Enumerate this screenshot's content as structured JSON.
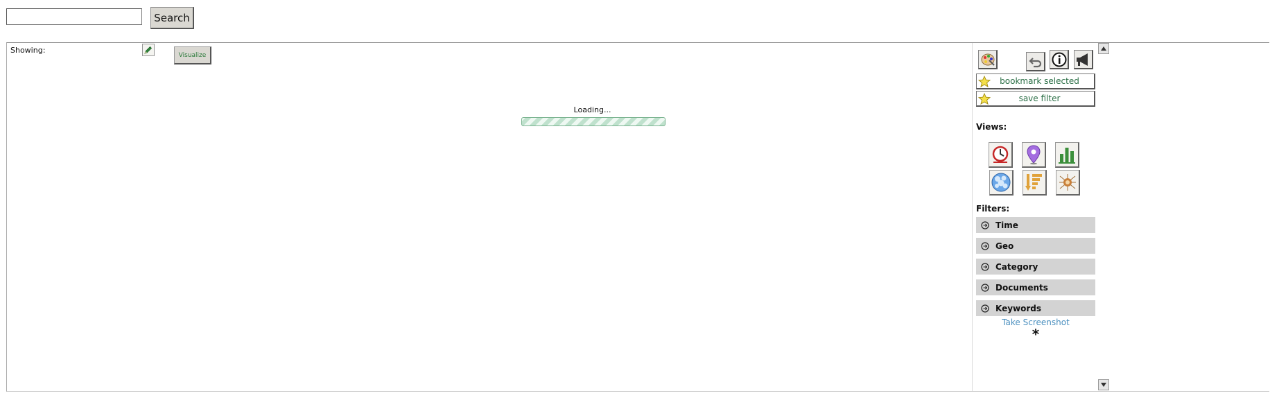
{
  "search": {
    "placeholder": "",
    "value": "",
    "button_label": "Search"
  },
  "main": {
    "showing_label": "Showing:",
    "visualize_label": "Visualize",
    "loading_text": "Loading..."
  },
  "toolbar": {
    "icons": [
      "palette-icon",
      "undo-icon",
      "info-icon",
      "megaphone-icon"
    ]
  },
  "actions": {
    "bookmark_label": "bookmark selected",
    "save_filter_label": "save filter"
  },
  "views": {
    "heading": "Views:",
    "items": [
      "timeline-view-icon",
      "map-view-icon",
      "bar-chart-view-icon",
      "tag-cloud-view-icon",
      "sorted-list-view-icon",
      "network-view-icon"
    ]
  },
  "filters": {
    "heading": "Filters:",
    "items": [
      {
        "label": "Time"
      },
      {
        "label": "Geo"
      },
      {
        "label": "Category"
      },
      {
        "label": "Documents"
      },
      {
        "label": "Keywords"
      }
    ]
  },
  "footer": {
    "screenshot_label": "Take Screenshot",
    "marker": "*"
  },
  "colors": {
    "button_bg": "#dad8d2",
    "link": "#4a8fbf",
    "accent_green": "#2a6e45",
    "filter_bg": "#d3d3d3"
  }
}
